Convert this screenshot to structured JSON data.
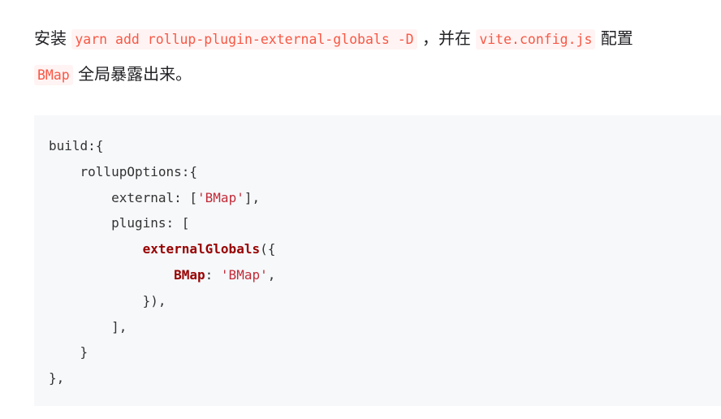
{
  "paragraph": {
    "text_install": "安装",
    "code_install": "yarn add rollup-plugin-external-globals -D",
    "text_comma_in": "，并在",
    "code_config": "vite.config.js",
    "text_config": "配置",
    "code_bmap": "BMap",
    "text_expose": "全局暴露出来。"
  },
  "code": {
    "indents": [
      "",
      "    ",
      "        ",
      "        ",
      "            ",
      "                ",
      "            ",
      "        ",
      "    ",
      ""
    ],
    "l1": "build:{",
    "l2": "rollupOptions:{",
    "l3_key": "external: [",
    "l3_str": "'BMap'",
    "l3_end": "],",
    "l4": "plugins: [",
    "l5_fn": "externalGlobals",
    "l5_end": "({",
    "l6_key": "BMap",
    "l6_colon": ": ",
    "l6_str": "'BMap'",
    "l6_end": ",",
    "l7": "}),",
    "l8": "],",
    "l9": "}",
    "l10": "},"
  }
}
